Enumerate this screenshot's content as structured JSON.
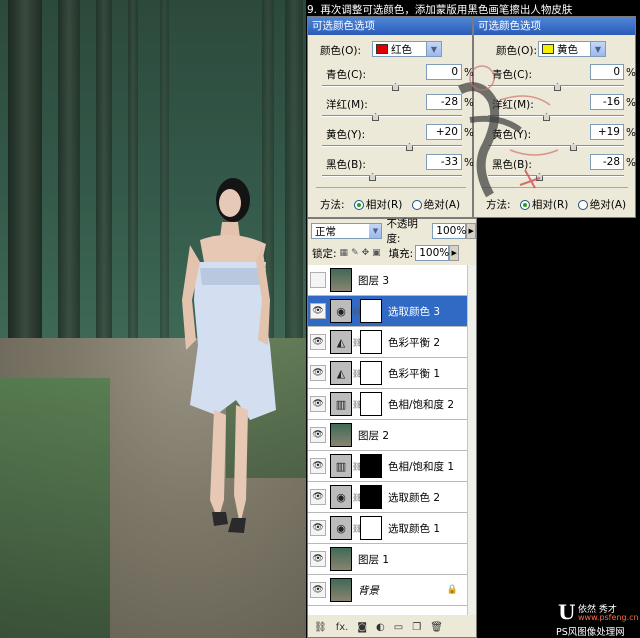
{
  "caption": "9. 再次调整可选颜色，添加蒙版用黑色画笔擦出人物皮肤",
  "dialog_left": {
    "title": "可选颜色选项",
    "color_label": "颜色(O):",
    "color_value": "红色",
    "swatch_color": "#e00000",
    "sliders": [
      {
        "label": "青色(C):",
        "value": "0",
        "unit": "%",
        "level": 0.5
      },
      {
        "label": "洋红(M):",
        "value": "-28",
        "unit": "%",
        "level": 0.36
      },
      {
        "label": "黄色(Y):",
        "value": "+20",
        "unit": "%",
        "level": 0.6
      },
      {
        "label": "黑色(B):",
        "value": "-33",
        "unit": "%",
        "level": 0.34
      }
    ],
    "method_label": "方法:",
    "method_relative": "相对(R)",
    "method_absolute": "绝对(A)"
  },
  "dialog_right": {
    "title": "可选颜色选项",
    "color_label": "颜色(O):",
    "color_value": "黄色",
    "swatch_color": "#f2f200",
    "sliders": [
      {
        "label": "青色(C):",
        "value": "0",
        "unit": "%",
        "level": 0.5
      },
      {
        "label": "洋红(M):",
        "value": "-16",
        "unit": "%",
        "level": 0.42
      },
      {
        "label": "黄色(Y):",
        "value": "+19",
        "unit": "%",
        "level": 0.6
      },
      {
        "label": "黑色(B):",
        "value": "-28",
        "unit": "%",
        "level": 0.36
      }
    ],
    "method_label": "方法:",
    "method_relative": "相对(R)",
    "method_absolute": "绝对(A)"
  },
  "layers_panel": {
    "blend_mode": "正常",
    "opacity_label": "不透明度:",
    "opacity_value": "100%",
    "lock_label": "锁定:",
    "fill_label": "填充:",
    "fill_value": "100%",
    "layers": [
      {
        "name": "图层 3",
        "kind": "image",
        "visible": false,
        "mask": "none",
        "selected": false
      },
      {
        "name": "选取颜色 3",
        "kind": "selective-color",
        "visible": true,
        "mask": "white",
        "selected": true
      },
      {
        "name": "色彩平衡 2",
        "kind": "color-balance",
        "visible": true,
        "mask": "white",
        "selected": false
      },
      {
        "name": "色彩平衡 1",
        "kind": "color-balance",
        "visible": true,
        "mask": "white",
        "selected": false
      },
      {
        "name": "色相/饱和度 2",
        "kind": "hue-saturation",
        "visible": true,
        "mask": "white",
        "selected": false
      },
      {
        "name": "图层 2",
        "kind": "image",
        "visible": true,
        "mask": "none",
        "selected": false
      },
      {
        "name": "色相/饱和度 1",
        "kind": "hue-saturation",
        "visible": true,
        "mask": "black",
        "selected": false
      },
      {
        "name": "选取颜色 2",
        "kind": "selective-color",
        "visible": true,
        "mask": "black",
        "selected": false
      },
      {
        "name": "选取颜色 1",
        "kind": "selective-color",
        "visible": true,
        "mask": "white",
        "selected": false
      },
      {
        "name": "图层 1",
        "kind": "image",
        "visible": true,
        "mask": "none",
        "selected": false
      },
      {
        "name": "背景",
        "kind": "background",
        "visible": true,
        "mask": "none",
        "selected": false
      }
    ],
    "bottom_fx": "fx."
  },
  "brand": {
    "line1": "依然 秀才",
    "line2": "www.psfeng.cn",
    "line3": "PS风图像处理网"
  }
}
